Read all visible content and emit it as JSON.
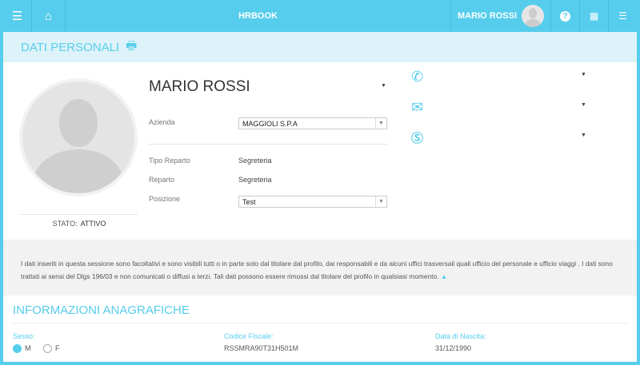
{
  "header": {
    "title": "HRBOOK",
    "user": "MARIO ROSSI"
  },
  "subheader": {
    "title": "DATI PERSONALI"
  },
  "profile": {
    "name": "MARIO ROSSI",
    "stato_label": "STATO:",
    "stato_value": "ATTIVO",
    "azienda_label": "Azienda",
    "azienda_value": "MAGGIOLI S.P.A",
    "tipo_reparto_label": "Tipo Reparto",
    "tipo_reparto_value": "Segreteria",
    "reparto_label": "Reparto",
    "reparto_value": "Segreteria",
    "posizione_label": "Posizione",
    "posizione_value": "Test"
  },
  "info_text": "I dati inseriti in questa sessione sono facoltativi e sono visibili tutti o in parte solo dal titolare dal profilo, dai responsabili e da alcuni uffici trasversali quali ufficio del personale e ufficio viaggi . I dati sono trattati ai sensi del Dlgs 196/03 e non comunicati o diffusi a terzi. Tali dati possono essere rimossi dal titolare del profilo in qualsiasi momento.",
  "anagrafica": {
    "title": "INFORMAZIONI ANAGRAFICHE",
    "sesso_label": "Sesso:",
    "sesso_m": "M",
    "sesso_f": "F",
    "cf_label": "Codice Fiscale:",
    "cf_value": "RSSMRA90T31H501M",
    "nascita_label": "Data di Nascita:",
    "nascita_value": "31/12/1990"
  }
}
